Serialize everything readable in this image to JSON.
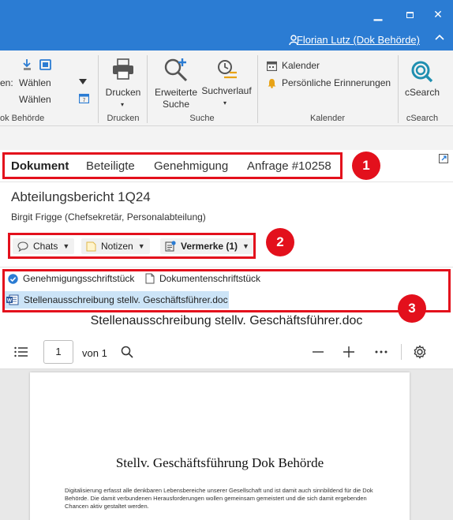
{
  "window": {
    "user_link": "Florian Lutz (Dok Behörde)",
    "minimize_glyph": "▁",
    "maximize_glyph": "■",
    "close_glyph": "✕",
    "collapse_glyph": "^"
  },
  "ribbon": {
    "group_left": {
      "prefix": "en:",
      "select1": "Wählen",
      "select2": "Wählen",
      "label": "ok Behörde"
    },
    "print": {
      "button": "Drucken",
      "label": "Drucken"
    },
    "search": {
      "advanced_line1": "Erweiterte",
      "advanced_line2": "Suche",
      "history": "Suchverlauf",
      "label": "Suche"
    },
    "calendar": {
      "calendar": "Kalender",
      "reminders": "Persönliche Erinnerungen",
      "label": "Kalender"
    },
    "csearch": {
      "button": "cSearch",
      "label": "cSearch"
    }
  },
  "tabs": [
    "Dokument",
    "Beteiligte",
    "Genehmigung",
    "Anfrage #10258"
  ],
  "badges": [
    "1",
    "2",
    "3"
  ],
  "document": {
    "title": "Abteilungsbericht 1Q24",
    "author": "Birgit Frigge (Chefsekretär, Personalabteilung)"
  },
  "dropdowns": {
    "chats": "Chats",
    "notes": "Notizen",
    "remarks": "Vermerke (1)"
  },
  "attachments": {
    "approval": "Genehmigungsschriftstück",
    "document": "Dokumentenschriftstück",
    "file": "Stellenausschreibung stellv. Geschäftsführer.doc"
  },
  "viewer": {
    "doc_name": "Stellenausschreibung stellv. Geschäftsführer.doc",
    "page_number": "1",
    "of_label": "von 1",
    "page_heading": "Stellv. Geschäftsführung Dok Behörde",
    "page_body": "Digitalisierung erfasst alle denkbaren Lebensbereiche unserer Gesellschaft und ist damit auch sinnbildend für die Dok Behörde. Die damit verbundenen Herausforderungen wollen gemeinsam gemeistert und die sich damit ergebenden Chancen aktiv gestaltet werden."
  },
  "colors": {
    "titlebar": "#2b7cd3",
    "annotation": "#e3101c",
    "selection": "#cce4f7"
  }
}
